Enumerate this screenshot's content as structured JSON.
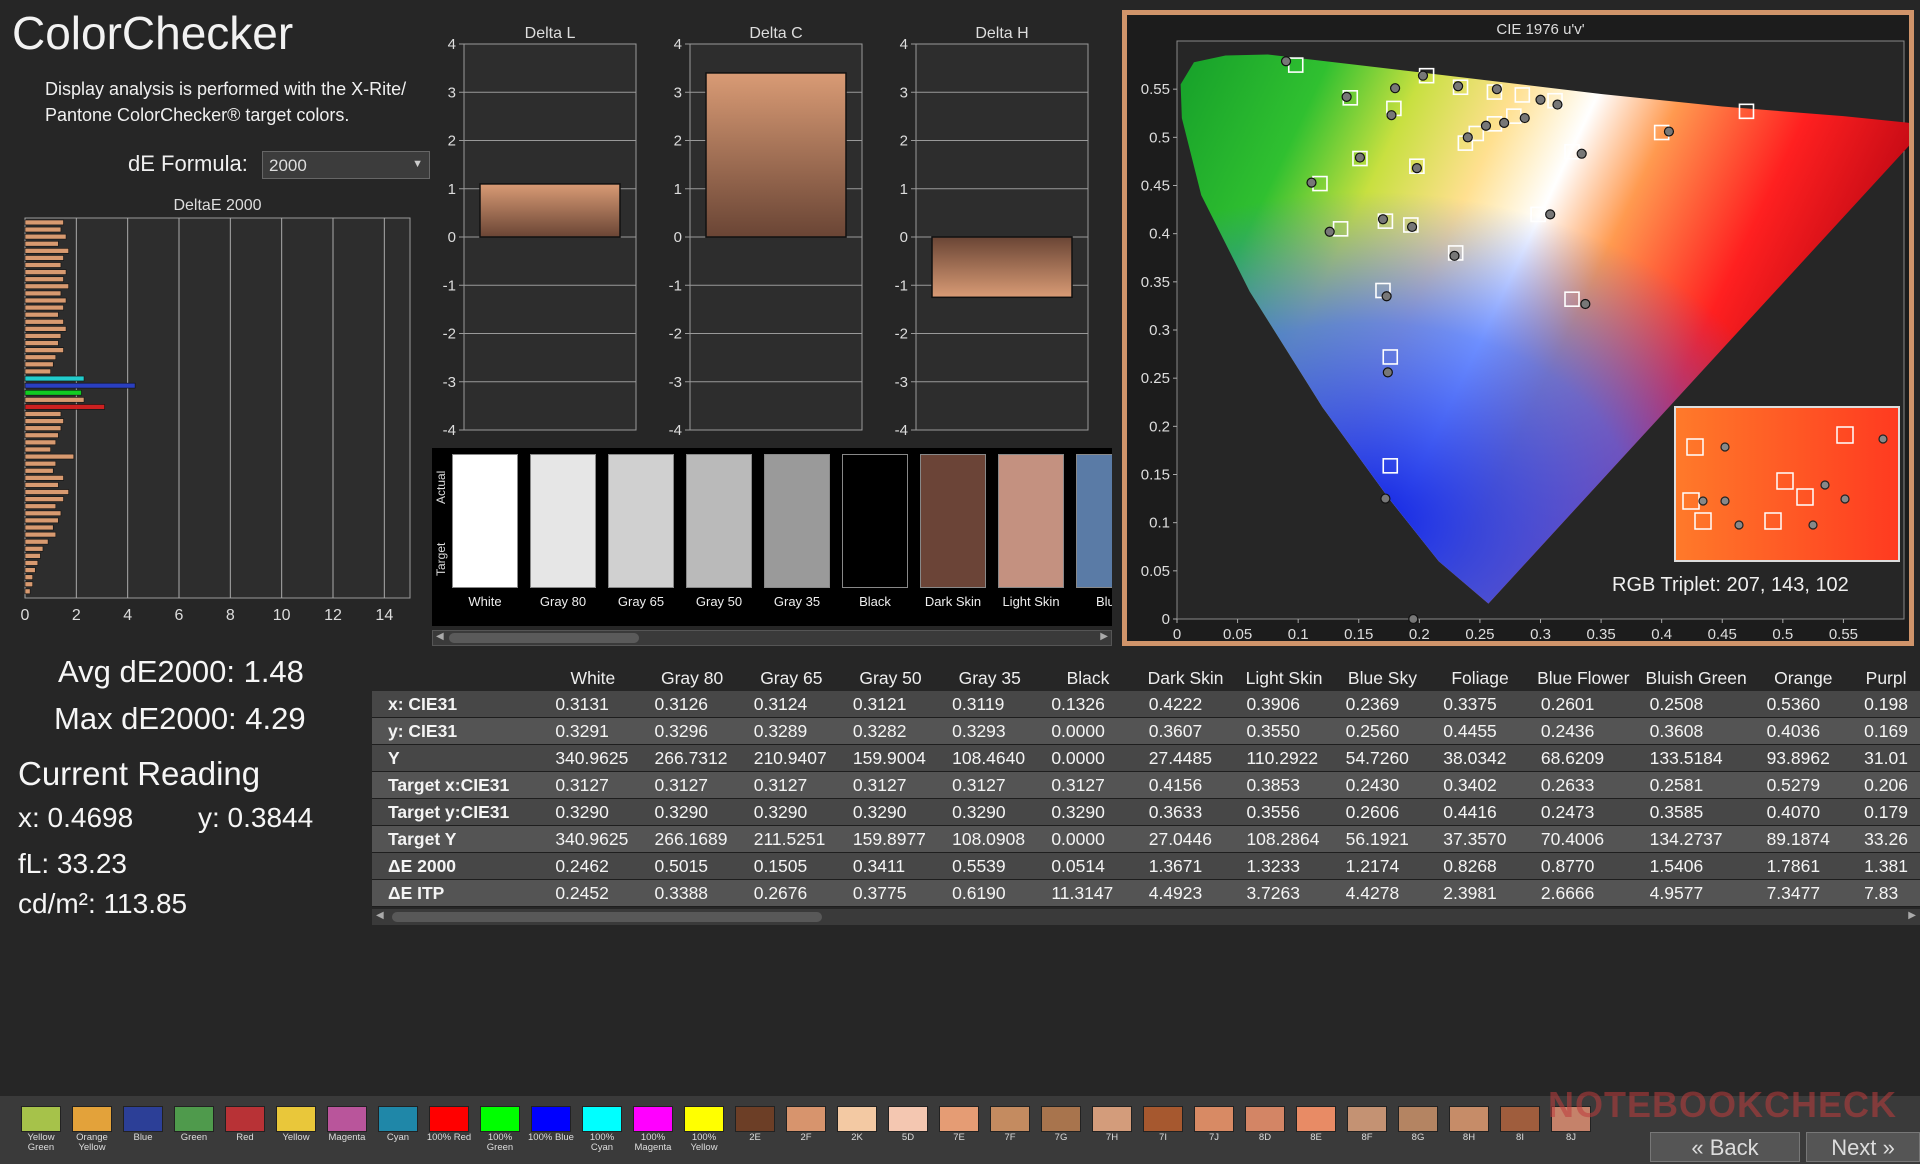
{
  "header": {
    "title": "ColorChecker",
    "description": "Display analysis is performed with the X-Rite/ Pantone ColorChecker® target colors.",
    "formula_label": "dE Formula:",
    "formula_value": "2000"
  },
  "summary": {
    "avg": "Avg dE2000: 1.48",
    "max": "Max dE2000: 4.29",
    "current_heading": "Current Reading",
    "x": "x: 0.4698",
    "y": "y: 0.3844",
    "fl": "fL: 33.23",
    "cdm2": "cd/m²: 113.85"
  },
  "chart_data": [
    {
      "type": "bar",
      "title": "DeltaE 2000",
      "orientation": "horizontal",
      "xlim": [
        0,
        15
      ],
      "xticks": [
        "0",
        "2",
        "4",
        "6",
        "8",
        "10",
        "12",
        "14"
      ],
      "values": [
        1.5,
        1.4,
        1.6,
        1.3,
        1.7,
        1.5,
        1.4,
        1.6,
        1.5,
        1.7,
        1.4,
        1.6,
        1.5,
        1.3,
        1.5,
        1.6,
        1.4,
        1.3,
        1.5,
        1.2,
        1.1,
        1.0,
        2.3,
        4.29,
        2.2,
        2.3,
        3.1,
        1.4,
        1.5,
        1.4,
        1.3,
        1.2,
        1.0,
        1.9,
        1.2,
        1.1,
        1.5,
        1.3,
        1.7,
        1.5,
        1.2,
        1.4,
        1.3,
        1.1,
        1.2,
        0.9,
        0.7,
        0.6,
        0.5,
        0.4,
        0.3,
        0.3,
        0.2
      ]
    },
    {
      "type": "bar",
      "title": "Delta L",
      "ylim": [
        -4,
        4
      ],
      "yticks": [
        "4",
        "3",
        "2",
        "1",
        "0",
        "-1",
        "-2",
        "-3",
        "-4"
      ],
      "values": [
        1.1
      ]
    },
    {
      "type": "bar",
      "title": "Delta C",
      "ylim": [
        -4,
        4
      ],
      "yticks": [
        "4",
        "3",
        "2",
        "1",
        "0",
        "-1",
        "-2",
        "-3",
        "-4"
      ],
      "values": [
        3.4
      ]
    },
    {
      "type": "bar",
      "title": "Delta H",
      "ylim": [
        -4,
        4
      ],
      "yticks": [
        "4",
        "3",
        "2",
        "1",
        "0",
        "-1",
        "-2",
        "-3",
        "-4"
      ],
      "values": [
        -1.25
      ]
    },
    {
      "type": "scatter",
      "title": "CIE 1976 u'v'",
      "xlim": [
        0,
        0.6
      ],
      "ylim": [
        0,
        0.6
      ],
      "xticks": [
        "0",
        "0.05",
        "0.1",
        "0.15",
        "0.2",
        "0.25",
        "0.3",
        "0.35",
        "0.4",
        "0.45",
        "0.5",
        "0.55"
      ],
      "yticks": [
        "0",
        "0.05",
        "0.1",
        "0.15",
        "0.2",
        "0.25",
        "0.3",
        "0.35",
        "0.4",
        "0.45",
        "0.5",
        "0.55"
      ],
      "targets": [
        [
          0.098,
          0.575
        ],
        [
          0.143,
          0.541
        ],
        [
          0.206,
          0.564
        ],
        [
          0.234,
          0.552
        ],
        [
          0.262,
          0.547
        ],
        [
          0.285,
          0.544
        ],
        [
          0.312,
          0.538
        ],
        [
          0.179,
          0.53
        ],
        [
          0.198,
          0.47
        ],
        [
          0.151,
          0.478
        ],
        [
          0.118,
          0.452
        ],
        [
          0.135,
          0.405
        ],
        [
          0.172,
          0.413
        ],
        [
          0.193,
          0.409
        ],
        [
          0.23,
          0.38
        ],
        [
          0.17,
          0.341
        ],
        [
          0.176,
          0.272
        ],
        [
          0.176,
          0.159
        ],
        [
          0.298,
          0.42
        ],
        [
          0.326,
          0.485
        ],
        [
          0.326,
          0.332
        ],
        [
          0.4,
          0.505
        ],
        [
          0.47,
          0.527
        ],
        [
          0.238,
          0.494
        ],
        [
          0.247,
          0.504
        ],
        [
          0.262,
          0.514
        ],
        [
          0.278,
          0.522
        ]
      ],
      "measured": [
        [
          0.09,
          0.579
        ],
        [
          0.14,
          0.542
        ],
        [
          0.18,
          0.551
        ],
        [
          0.177,
          0.523
        ],
        [
          0.203,
          0.564
        ],
        [
          0.232,
          0.553
        ],
        [
          0.264,
          0.55
        ],
        [
          0.3,
          0.539
        ],
        [
          0.314,
          0.534
        ],
        [
          0.151,
          0.479
        ],
        [
          0.198,
          0.468
        ],
        [
          0.111,
          0.453
        ],
        [
          0.126,
          0.402
        ],
        [
          0.17,
          0.415
        ],
        [
          0.194,
          0.407
        ],
        [
          0.229,
          0.377
        ],
        [
          0.173,
          0.335
        ],
        [
          0.174,
          0.256
        ],
        [
          0.172,
          0.125
        ],
        [
          0.308,
          0.42
        ],
        [
          0.334,
          0.483
        ],
        [
          0.337,
          0.327
        ],
        [
          0.406,
          0.506
        ],
        [
          0.24,
          0.5
        ],
        [
          0.255,
          0.512
        ],
        [
          0.27,
          0.515
        ],
        [
          0.287,
          0.52
        ],
        [
          0.195,
          0.0
        ]
      ],
      "rgb_triplet": "RGB Triplet: 207, 143, 102"
    }
  ],
  "swatch_strip": {
    "actual_label": "Actual",
    "target_label": "Target",
    "items": [
      {
        "name": "White",
        "color": "#ffffff"
      },
      {
        "name": "Gray 80",
        "color": "#e6e6e6"
      },
      {
        "name": "Gray 65",
        "color": "#d0d0d0"
      },
      {
        "name": "Gray 50",
        "color": "#bababa"
      },
      {
        "name": "Gray 35",
        "color": "#9a9a9a"
      },
      {
        "name": "Black",
        "color": "#000000"
      },
      {
        "name": "Dark Skin",
        "color": "#6b4437"
      },
      {
        "name": "Light Skin",
        "color": "#c49180"
      },
      {
        "name": "Blue",
        "color": "#5a7ba6"
      }
    ]
  },
  "table": {
    "columns": [
      "White",
      "Gray 80",
      "Gray 65",
      "Gray 50",
      "Gray 35",
      "Black",
      "Dark Skin",
      "Light Skin",
      "Blue Sky",
      "Foliage",
      "Blue Flower",
      "Bluish Green",
      "Orange",
      "Purpl"
    ],
    "rows": [
      {
        "label": "x: CIE31",
        "values": [
          "0.3131",
          "0.3126",
          "0.3124",
          "0.3121",
          "0.3119",
          "0.1326",
          "0.4222",
          "0.3906",
          "0.2369",
          "0.3375",
          "0.2601",
          "0.2508",
          "0.5360",
          "0.198"
        ]
      },
      {
        "label": "y: CIE31",
        "values": [
          "0.3291",
          "0.3296",
          "0.3289",
          "0.3282",
          "0.3293",
          "0.0000",
          "0.3607",
          "0.3550",
          "0.2560",
          "0.4455",
          "0.2436",
          "0.3608",
          "0.4036",
          "0.169"
        ]
      },
      {
        "label": "Y",
        "values": [
          "340.9625",
          "266.7312",
          "210.9407",
          "159.9004",
          "108.4640",
          "0.0000",
          "27.4485",
          "110.2922",
          "54.7260",
          "38.0342",
          "68.6209",
          "133.5184",
          "93.8962",
          "31.01"
        ]
      },
      {
        "label": "Target x:CIE31",
        "values": [
          "0.3127",
          "0.3127",
          "0.3127",
          "0.3127",
          "0.3127",
          "0.3127",
          "0.4156",
          "0.3853",
          "0.2430",
          "0.3402",
          "0.2633",
          "0.2581",
          "0.5279",
          "0.206"
        ]
      },
      {
        "label": "Target y:CIE31",
        "values": [
          "0.3290",
          "0.3290",
          "0.3290",
          "0.3290",
          "0.3290",
          "0.3290",
          "0.3633",
          "0.3556",
          "0.2606",
          "0.4416",
          "0.2473",
          "0.3585",
          "0.4070",
          "0.179"
        ]
      },
      {
        "label": "Target Y",
        "values": [
          "340.9625",
          "266.1689",
          "211.5251",
          "159.8977",
          "108.0908",
          "0.0000",
          "27.0446",
          "108.2864",
          "56.1921",
          "37.3570",
          "70.4006",
          "134.2737",
          "89.1874",
          "33.26"
        ]
      },
      {
        "label": "ΔE 2000",
        "values": [
          "0.2462",
          "0.5015",
          "0.1505",
          "0.3411",
          "0.5539",
          "0.0514",
          "1.3671",
          "1.3233",
          "1.2174",
          "0.8268",
          "0.8770",
          "1.5406",
          "1.7861",
          "1.381"
        ]
      },
      {
        "label": "ΔE ITP",
        "values": [
          "0.2452",
          "0.3388",
          "0.2676",
          "0.3775",
          "0.6190",
          "11.3147",
          "4.4923",
          "3.7263",
          "4.4278",
          "2.3981",
          "2.6666",
          "4.9577",
          "7.3477",
          "7.83"
        ]
      }
    ]
  },
  "patches": [
    {
      "label": "Yellow Green",
      "color": "#a6c24a"
    },
    {
      "label": "Orange Yellow",
      "color": "#e3a23a"
    },
    {
      "label": "Blue",
      "color": "#2c3f97"
    },
    {
      "label": "Green",
      "color": "#4f9a4c"
    },
    {
      "label": "Red",
      "color": "#b83236"
    },
    {
      "label": "Yellow",
      "color": "#e9c73a"
    },
    {
      "label": "Magenta",
      "color": "#b9559b"
    },
    {
      "label": "Cyan",
      "color": "#1f87a8"
    },
    {
      "label": "100% Red",
      "color": "#ff0000"
    },
    {
      "label": "100% Green",
      "color": "#00ff00"
    },
    {
      "label": "100% Blue",
      "color": "#0000ff"
    },
    {
      "label": "100% Cyan",
      "color": "#00ffff"
    },
    {
      "label": "100% Magenta",
      "color": "#ff00ff"
    },
    {
      "label": "100% Yellow",
      "color": "#ffff00"
    },
    {
      "label": "2E",
      "color": "#6c3e26"
    },
    {
      "label": "2F",
      "color": "#d7946d"
    },
    {
      "label": "2K",
      "color": "#f3c9a3"
    },
    {
      "label": "5D",
      "color": "#f4c7b1"
    },
    {
      "label": "7E",
      "color": "#e59c74"
    },
    {
      "label": "7F",
      "color": "#c48b60"
    },
    {
      "label": "7G",
      "color": "#a8744d"
    },
    {
      "label": "7H",
      "color": "#d39c7b"
    },
    {
      "label": "7I",
      "color": "#a6582f"
    },
    {
      "label": "7J",
      "color": "#d88a64"
    },
    {
      "label": "8D",
      "color": "#d38565"
    },
    {
      "label": "8E",
      "color": "#e88b65"
    },
    {
      "label": "8F",
      "color": "#c49273"
    },
    {
      "label": "8G",
      "color": "#b48462"
    },
    {
      "label": "8H",
      "color": "#c68c68"
    },
    {
      "label": "8I",
      "color": "#9f5d3d"
    },
    {
      "label": "8J",
      "color": "#c5826a"
    }
  ],
  "nav": {
    "back": "Back",
    "next": "Next"
  },
  "watermark": "NOTEBOOKCHECK"
}
